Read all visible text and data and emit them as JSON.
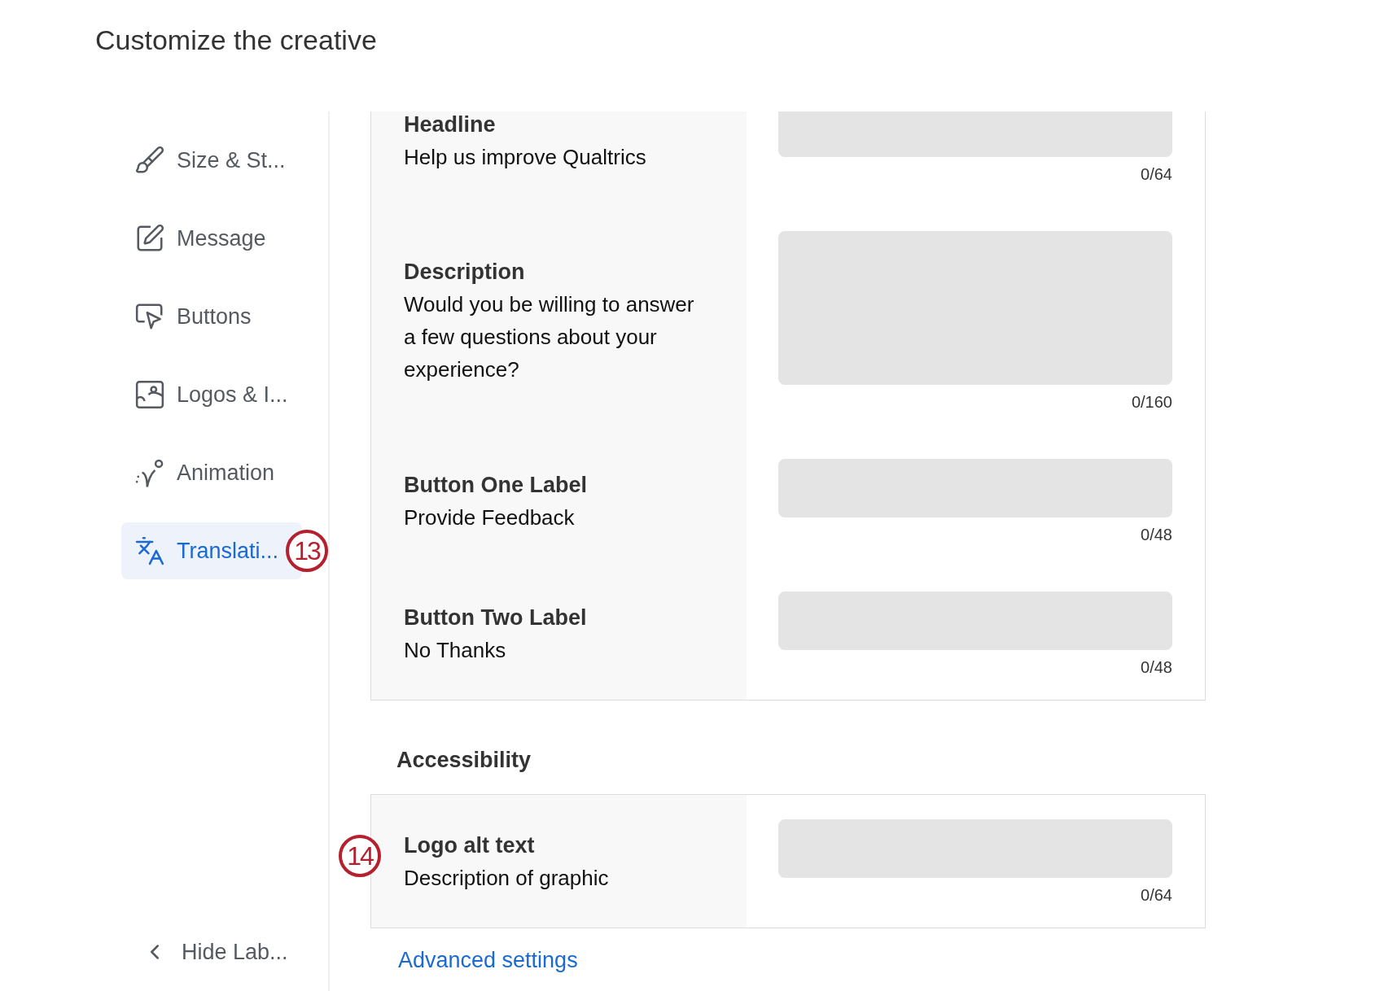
{
  "title": "Customize the creative",
  "sidebar": {
    "items": [
      {
        "label": "Size & St...",
        "selected": false
      },
      {
        "label": "Message",
        "selected": false
      },
      {
        "label": "Buttons",
        "selected": false
      },
      {
        "label": "Logos & I...",
        "selected": false
      },
      {
        "label": "Animation",
        "selected": false
      },
      {
        "label": "Translati...",
        "selected": true,
        "callout": "13"
      }
    ],
    "footer": {
      "label": "Hide Lab..."
    }
  },
  "fields": [
    {
      "label": "Headline",
      "text": "Help us improve Qualtrics",
      "kind": "single",
      "counter": "0/64"
    },
    {
      "label": "Description",
      "text": "Would you be willing to answer a few questions about your experience?",
      "kind": "multi",
      "counter": "0/160"
    },
    {
      "label": "Button One Label",
      "text": "Provide Feedback",
      "kind": "single",
      "counter": "0/48"
    },
    {
      "label": "Button Two Label",
      "text": "No Thanks",
      "kind": "single",
      "counter": "0/48"
    }
  ],
  "accessibility": {
    "heading": "Accessibility",
    "fields": [
      {
        "label": "Logo alt text",
        "text": "Description of graphic",
        "kind": "single",
        "counter": "0/64",
        "callout": "14"
      }
    ]
  },
  "link": "Advanced settings"
}
